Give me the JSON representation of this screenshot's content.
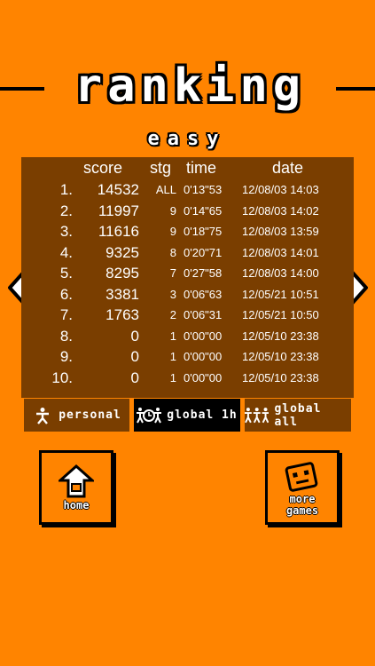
{
  "title": "ranking",
  "difficulty": "easy",
  "headers": {
    "score": "score",
    "stg": "stg",
    "time": "time",
    "date": "date"
  },
  "rows": [
    {
      "rank": "1.",
      "score": "14532",
      "stg": "ALL",
      "time": "0'13\"53",
      "date": "12/08/03 14:03"
    },
    {
      "rank": "2.",
      "score": "11997",
      "stg": "9",
      "time": "0'14\"65",
      "date": "12/08/03 14:02"
    },
    {
      "rank": "3.",
      "score": "11616",
      "stg": "9",
      "time": "0'18\"75",
      "date": "12/08/03 13:59"
    },
    {
      "rank": "4.",
      "score": "9325",
      "stg": "8",
      "time": "0'20\"71",
      "date": "12/08/03 14:01"
    },
    {
      "rank": "5.",
      "score": "8295",
      "stg": "7",
      "time": "0'27\"58",
      "date": "12/08/03 14:00"
    },
    {
      "rank": "6.",
      "score": "3381",
      "stg": "3",
      "time": "0'06\"63",
      "date": "12/05/21 10:51"
    },
    {
      "rank": "7.",
      "score": "1763",
      "stg": "2",
      "time": "0'06\"31",
      "date": "12/05/21 10:50"
    },
    {
      "rank": "8.",
      "score": "0",
      "stg": "1",
      "time": "0'00\"00",
      "date": "12/05/10 23:38"
    },
    {
      "rank": "9.",
      "score": "0",
      "stg": "1",
      "time": "0'00\"00",
      "date": "12/05/10 23:38"
    },
    {
      "rank": "10.",
      "score": "0",
      "stg": "1",
      "time": "0'00\"00",
      "date": "12/05/10 23:38"
    }
  ],
  "tabs": [
    {
      "label": "personal",
      "icon": "person-icon",
      "selected": false
    },
    {
      "label": "global 1h",
      "icon": "clock-people-icon",
      "selected": true
    },
    {
      "label": "global all",
      "icon": "people-icon",
      "selected": false
    }
  ],
  "buttons": {
    "home": "home",
    "more_line1": "more",
    "more_line2": "games"
  },
  "colors": {
    "background": "#ff8400",
    "panel": "#7a3e00",
    "text": "#ffffff",
    "outline": "#000000"
  }
}
